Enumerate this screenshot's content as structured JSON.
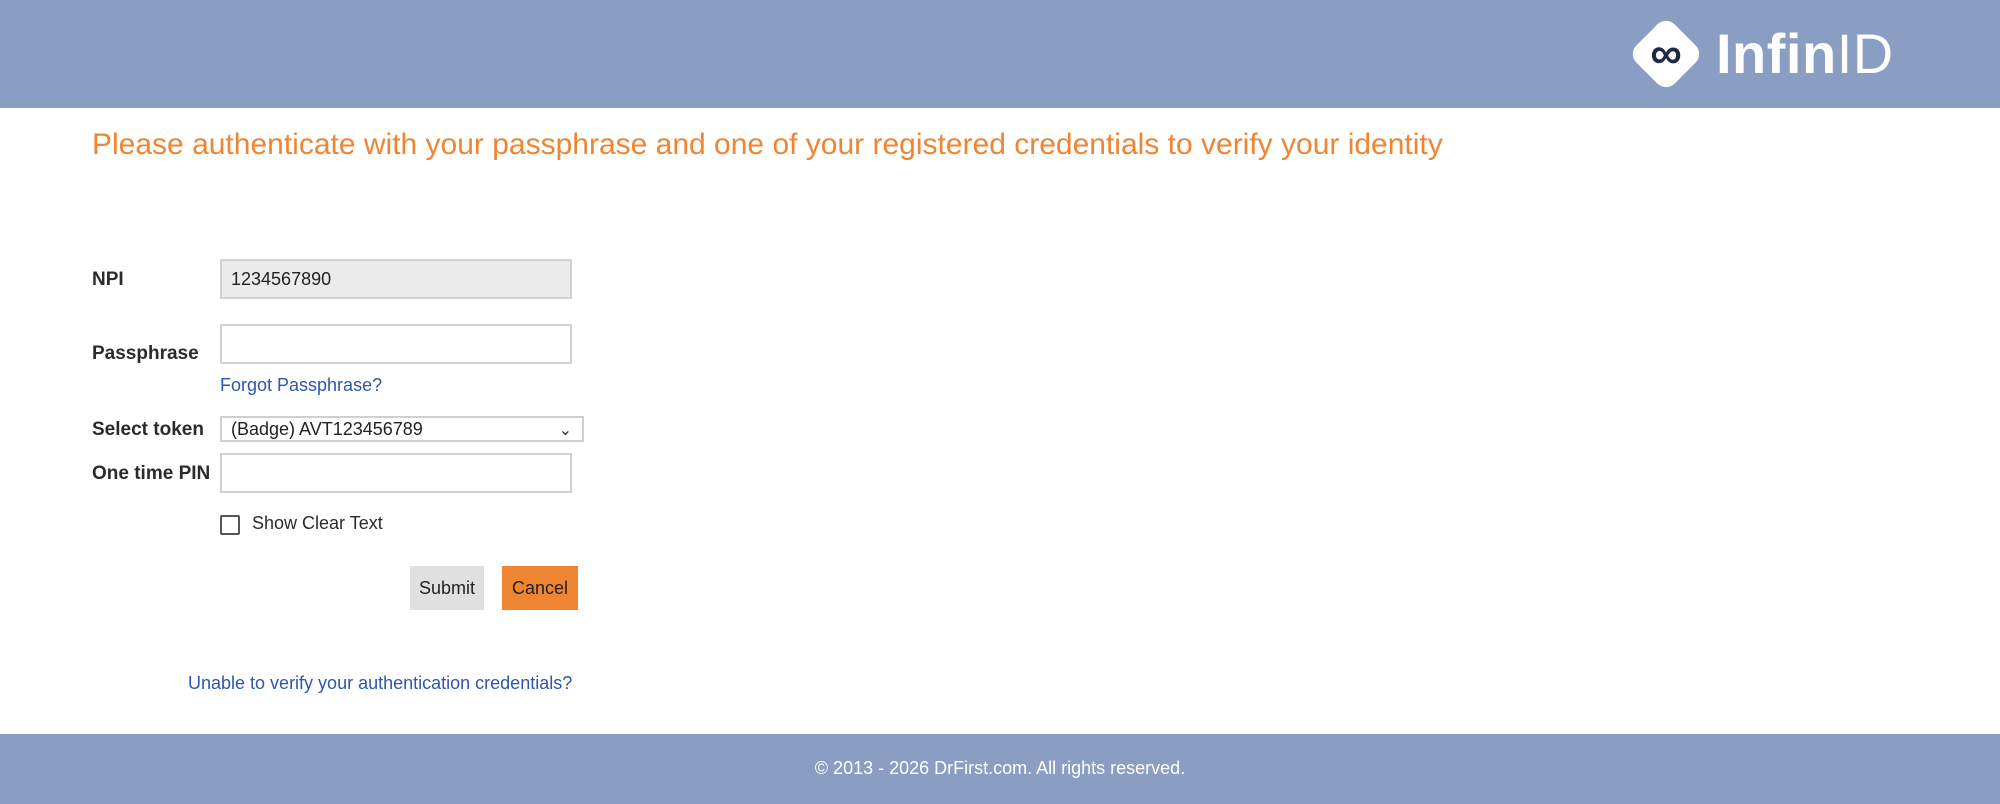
{
  "header": {
    "brand_mark": "∞",
    "brand_bold": "Infin",
    "brand_light": "ID",
    "background_color": "#8a9dc2"
  },
  "main": {
    "title": "Please authenticate with your passphrase and one of your registered credentials to verify your identity",
    "title_color": "#ef8532"
  },
  "form": {
    "npi_label": "NPI",
    "npi_value": "1234567890",
    "passphrase_label": "Passphrase",
    "passphrase_value": "",
    "forgot_link": "Forgot Passphrase?",
    "token_label": "Select token",
    "token_selected": "(Badge) AVT123456789",
    "token_chevron_icon": "chevron-down-icon",
    "pin_label": "One time PIN",
    "pin_value": "",
    "show_clear_text_label": "Show Clear Text",
    "show_clear_text_checked": false,
    "submit_label": "Submit",
    "cancel_label": "Cancel",
    "cancel_color": "#ef8532",
    "unable_link": "Unable to verify your authentication credentials?",
    "link_color": "#2f55b0"
  },
  "footer": {
    "copyright": "© 2013 - 2026 DrFirst.com. All rights reserved."
  }
}
